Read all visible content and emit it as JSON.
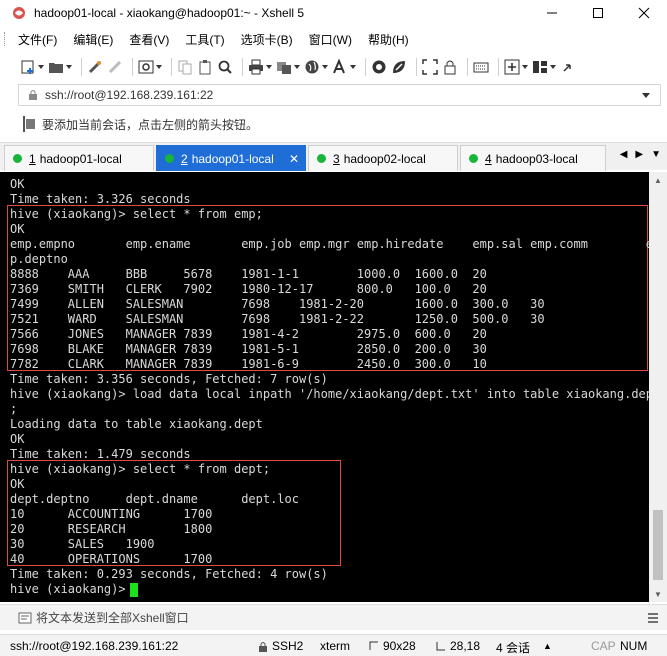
{
  "window": {
    "title": "hadoop01-local - xiaokang@hadoop01:~ - Xshell 5",
    "minimize_icon": "minimize-icon",
    "maximize_icon": "maximize-icon",
    "close_icon": "close-icon"
  },
  "menu": [
    "文件(F)",
    "编辑(E)",
    "查看(V)",
    "工具(T)",
    "选项卡(B)",
    "窗口(W)",
    "帮助(H)"
  ],
  "toolbar": {
    "icons": [
      "new-session-icon",
      "open-folder-icon",
      "reconnect-icon",
      "disconnect-icon",
      "properties-icon",
      "copy-icon",
      "paste-icon",
      "find-icon",
      "print-icon",
      "transfer-icon",
      "globe-icon",
      "font-icon",
      "xftp-icon",
      "xmanager-icon",
      "fullscreen-icon",
      "lock-icon",
      "keyboard-icon",
      "compose-icon",
      "layout-icon",
      "help-icon"
    ]
  },
  "address": {
    "value": "ssh://root@192.168.239.161:22"
  },
  "hint": {
    "text": "要添加当前会话，点击左侧的箭头按钮。"
  },
  "tabs": [
    {
      "num": "1",
      "label": "hadoop01-local",
      "active": false
    },
    {
      "num": "2",
      "label": "hadoop01-local",
      "active": true
    },
    {
      "num": "3",
      "label": "hadoop02-local",
      "active": false
    },
    {
      "num": "4",
      "label": "hadoop03-local",
      "active": false
    }
  ],
  "terminal": {
    "lines": [
      "OK",
      "Time taken: 3.326 seconds",
      "hive (xiaokang)> select * from emp;",
      "OK",
      "emp.empno       emp.ename       emp.job emp.mgr emp.hiredate    emp.sal emp.comm        em",
      "p.deptno",
      "8888    AAA     BBB     5678    1981-1-1        1000.0  1600.0  20",
      "7369    SMITH   CLERK   7902    1980-12-17      800.0   100.0   20",
      "7499    ALLEN   SALESMAN        7698    1981-2-20       1600.0  300.0   30",
      "7521    WARD    SALESMAN        7698    1981-2-22       1250.0  500.0   30",
      "7566    JONES   MANAGER 7839    1981-4-2        2975.0  600.0   20",
      "7698    BLAKE   MANAGER 7839    1981-5-1        2850.0  200.0   30",
      "7782    CLARK   MANAGER 7839    1981-6-9        2450.0  300.0   10",
      "Time taken: 3.356 seconds, Fetched: 7 row(s)",
      "hive (xiaokang)> load data local inpath '/home/xiaokang/dept.txt' into table xiaokang.dept",
      ";",
      "Loading data to table xiaokang.dept",
      "OK",
      "Time taken: 1.479 seconds",
      "hive (xiaokang)> select * from dept;",
      "OK",
      "dept.deptno     dept.dname      dept.loc",
      "10      ACCOUNTING      1700",
      "20      RESEARCH        1800",
      "30      SALES   1900",
      "40      OPERATIONS      1700",
      "Time taken: 0.293 seconds, Fetched: 4 row(s)",
      "hive (xiaokang)> "
    ]
  },
  "sendbar": {
    "text": "将文本发送到全部Xshell窗口"
  },
  "status": {
    "connection": "ssh://root@192.168.239.161:22",
    "protocol": "SSH2",
    "terminal": "xterm",
    "size": "90x28",
    "position": "28,18",
    "sessions": "4 会话",
    "caps": "CAP",
    "num": "NUM"
  },
  "colors": {
    "active_tab": "#1f6ed8",
    "tab_dot": "#16b53a",
    "highlight_box": "#e0493f",
    "cursor": "#1ee11e",
    "terminal_bg": "#000000",
    "terminal_fg": "#d9d9d9"
  }
}
